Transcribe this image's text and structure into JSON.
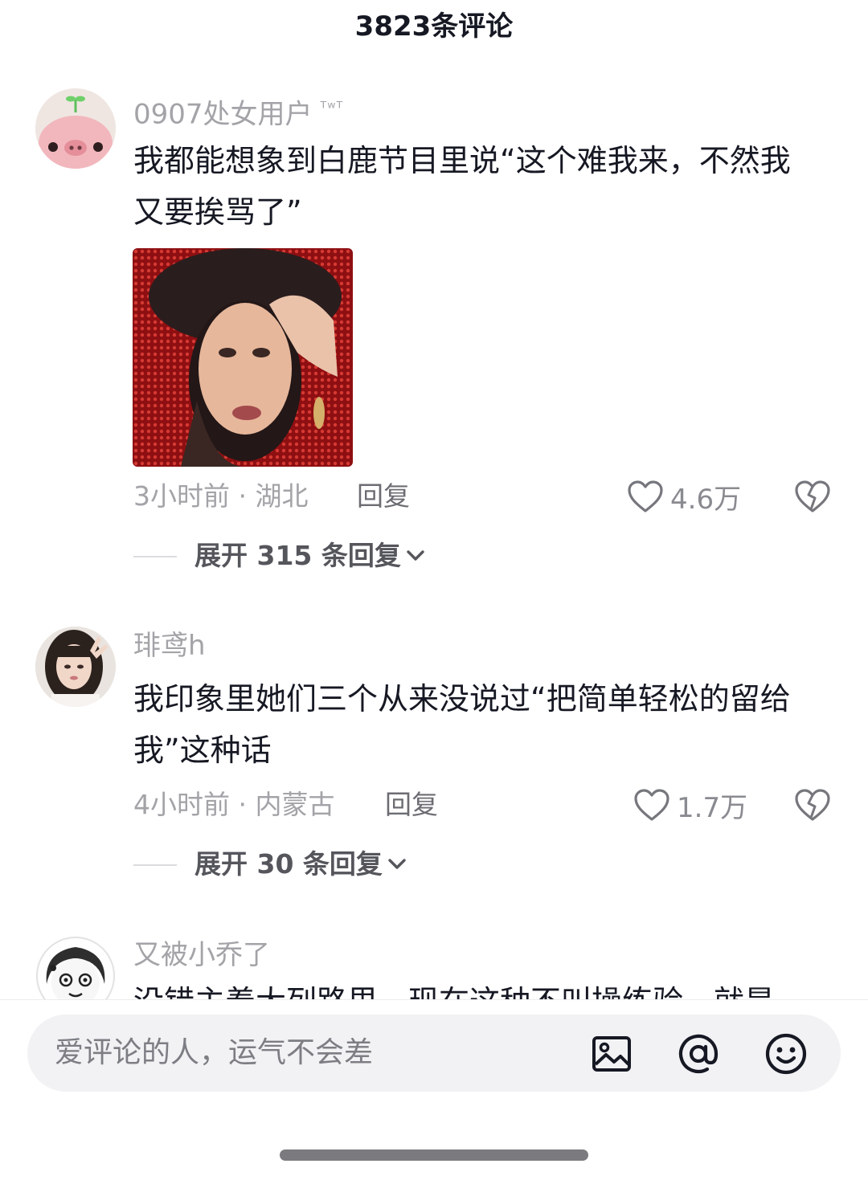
{
  "header": {
    "title": "3823条评论"
  },
  "comments": [
    {
      "username": "0907处女用户",
      "username_suffix": "ᵀʷᵀ",
      "text": "我都能想象到白鹿节目里说“这个难我来，不然我\n又要挨骂了”",
      "time_location": "3小时前 · 湖北",
      "reply_label": "回复",
      "likes": "4.6万",
      "expand_label": "展开 315 条回复"
    },
    {
      "username": "琲鸢h",
      "text": "我印象里她们三个从来没说过“把简单轻松的留给\n我”这种话",
      "time_location": "4小时前 · 内蒙古",
      "reply_label": "回复",
      "likes": "1.7万",
      "expand_label": "展开 30 条回复"
    },
    {
      "username": "又被小乔了",
      "text": "没错主着大列路里，现在这种不叫操练验，就是"
    }
  ],
  "input": {
    "placeholder": "爱评论的人，运气不会差"
  },
  "icons": {
    "image": "image-icon",
    "mention": "at-mention-icon",
    "emoji": "emoji-icon",
    "like": "heart-icon",
    "dislike": "broken-heart-icon",
    "expand": "chevron-down-icon"
  },
  "colors": {
    "text_primary": "#161823",
    "text_secondary": "#a3a3a8",
    "input_bg": "#f2f2f4"
  }
}
